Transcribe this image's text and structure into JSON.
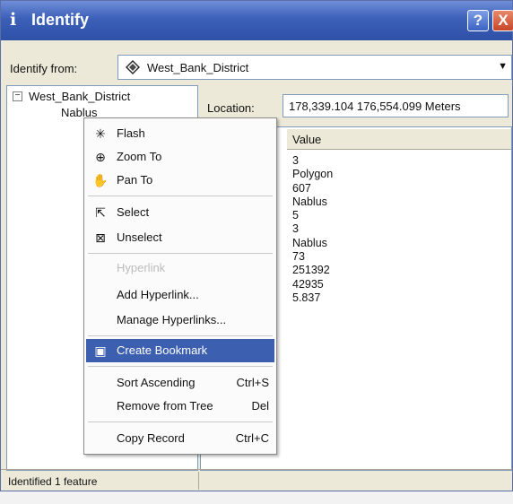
{
  "window": {
    "title": "Identify",
    "title_icon": "i",
    "help_label": "?",
    "close_label": "X"
  },
  "identify_from": {
    "label": "Identify from:",
    "value": "West_Bank_District",
    "arrow": "▼"
  },
  "tree": {
    "expander": "−",
    "root": "West_Bank_District",
    "child": "Nablus"
  },
  "location": {
    "label": "Location:",
    "value": "178,339.104  176,554.099 Meters"
  },
  "grid": {
    "value_header": "Value",
    "values": [
      "3",
      "Polygon",
      "607",
      "Nablus",
      "5",
      "3",
      "Nablus",
      "73",
      "251392",
      "42935",
      "5.837"
    ]
  },
  "context_menu": {
    "items": [
      {
        "label": "Flash",
        "icon": "flash-icon",
        "shortcut": ""
      },
      {
        "label": "Zoom To",
        "icon": "zoom-icon",
        "shortcut": ""
      },
      {
        "label": "Pan To",
        "icon": "pan-icon",
        "shortcut": ""
      },
      {
        "label": "Select",
        "icon": "select-icon",
        "shortcut": ""
      },
      {
        "label": "Unselect",
        "icon": "unselect-icon",
        "shortcut": ""
      },
      {
        "label": "Hyperlink",
        "icon": "",
        "shortcut": "",
        "disabled": true
      },
      {
        "label": "Add Hyperlink...",
        "icon": "",
        "shortcut": ""
      },
      {
        "label": "Manage Hyperlinks...",
        "icon": "",
        "shortcut": ""
      },
      {
        "label": "Create Bookmark",
        "icon": "bookmark-icon",
        "shortcut": "",
        "highlighted": true
      },
      {
        "label": "Sort Ascending",
        "icon": "",
        "shortcut": "Ctrl+S"
      },
      {
        "label": "Remove from Tree",
        "icon": "",
        "shortcut": "Del"
      },
      {
        "label": "Copy Record",
        "icon": "",
        "shortcut": "Ctrl+C"
      }
    ]
  },
  "status": {
    "text": "Identified 1 feature"
  },
  "colors": {
    "titlebar": "#3c5fb8",
    "highlight": "#3c5fb0"
  }
}
